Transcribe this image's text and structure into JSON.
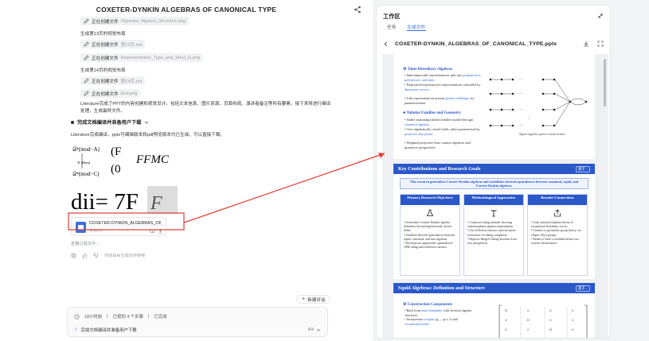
{
  "chat": {
    "title": "COXETER-DYNKIN ALGEBRAS OF CANONICAL TYPE",
    "steps": [
      {
        "type": "file",
        "label": "正在创建文件",
        "file": "Opposite_Algebra_Structure.png"
      },
      {
        "type": "text",
        "text": "生成第13页的视觉布局"
      },
      {
        "type": "file",
        "label": "正在创建文件",
        "file": "第13页.md"
      },
      {
        "type": "file",
        "label": "正在创建文件",
        "file": "Representation_Type_and_Weyl_G.png"
      },
      {
        "type": "text",
        "text": "生成第14页的视觉布局"
      },
      {
        "type": "file",
        "label": "正在创建文件",
        "file": "第14页.md"
      },
      {
        "type": "file",
        "label": "正在创建文件",
        "file": "End.png"
      }
    ],
    "summary": "Literature完成了PPT的内容创建和视觉设计。包括文本信息、图片资源、页面布局、演讲者备注等所有要素。接下来将进行编译处理，生成最终文件。",
    "task_heading": "完成文档编译并准备用户下载",
    "done_text": "Literature完成编译，pptx可编辑版本和pdf预览版本均已生成。可以直接下载。",
    "file_card": {
      "name": "COXETER-DYNKIN_ALGEBRAS_OF_...",
      "type": "学术PPT"
    },
    "view_process": "查看过程文件 ›",
    "ref_text": "内容由AI生成仅供参考",
    "new_chat": "新建对话",
    "status": {
      "elapsed": "18小时前",
      "steps_planned": "已规划 4 个步骤",
      "completed": "已完成",
      "current_task": "完成文档编译并准备用户下载",
      "count": "4/4"
    },
    "thumb": {
      "m1": "𝒟ᵇ(mod−A)",
      "m2": "𝒟ᵇ(mod−C)",
      "arrow_label": "≅ |Hom(",
      "big1": "(F",
      "big2": "(0",
      "big3": "FFMC",
      "bottom": "dii= 7F",
      "bottom2": "F"
    }
  },
  "workspace": {
    "title": "工作区",
    "tabs": [
      "任务",
      "生成文件"
    ],
    "active_tab": 1,
    "doc_name": "COXETER-DYNKIN_ALGEBRAS_OF_CANONICAL_TYPE.pptx",
    "slide1": {
      "h1": "Tame Hereditary Algebras",
      "b1a_pre": "Indecomposable representations split into ",
      "b1a_links": "preprojective, preinjective, and tubes",
      "b1b_pre": "Preprojective/preinjective representations controlled by ",
      "b1b_link": "dimension vectors",
      "b1c_pre": "Tube representations present ",
      "b1c_link": "greater challenges",
      "b1c_post": " for parametrization",
      "h2": "Tubular Families and Geometry",
      "b2a_pre": "Stable separating tubular families studied through ",
      "b2a_link": "canonical algebras",
      "b2b_pre": "Over algebraically closed fields, tubes parametrized by ",
      "b2b_link": "projective line points",
      "b2c": "Weighted projective lines connect algebraic and geometric perspectives",
      "caption": "Squid algebra quiver construction"
    },
    "slide2": {
      "title": "Key Contributions and Research Goals",
      "logo": "基于...",
      "goal": "This research generalizes Coxeter-Dynkin algebras and establishes derived equivalences between canonical, squid, and Coxeter-Dynkin algebras.",
      "cols": [
        {
          "head": "Primary Research Objectives",
          "icon": "flask-icon",
          "text": [
            "Generalize Coxeter-Dynkin algebra definition beyond algebraically closed fields",
            "Establish derived equivalences between squid, canonical, and new algebras",
            "Develop two approaches: generalized APR tilting and reflection functors"
          ]
        },
        {
          "head": "Methodological Approaches",
          "icon": "text-icon",
          "text": [
            "Construct tilting modules showing endomorphism algebra isomorphism",
            "Use reflection functors and one-point extensions for tilting complexes",
            "Reprove Ringel's tilting theorem from new perspective"
          ]
        },
        {
          "head": "Broader Connections",
          "icon": "share-icon",
          "text": [
            "Link canonical algebra theory to exceptional hereditary curves",
            "Connect to geometric group theory via elliptic Weyl groups",
            "Relate to Saito's extended affine root system classification"
          ]
        }
      ]
    },
    "slide3": {
      "title": "Squid Algebras: Definition and Structure",
      "h": "Construction Components",
      "b1_pre": "Built from ",
      "b1_link": "tame bimodules",
      "b1_post": " with division algebra structures",
      "b2_pre": "Incorporates ",
      "b2_link": "weights",
      "b2_post": " (p₁,...,pₜ ≥ 2) and",
      "b3_link": "exceptional points"
    }
  },
  "colors": {
    "accent": "#2b58c9",
    "link": "#2f6bde",
    "arrow": "#e03b35"
  }
}
